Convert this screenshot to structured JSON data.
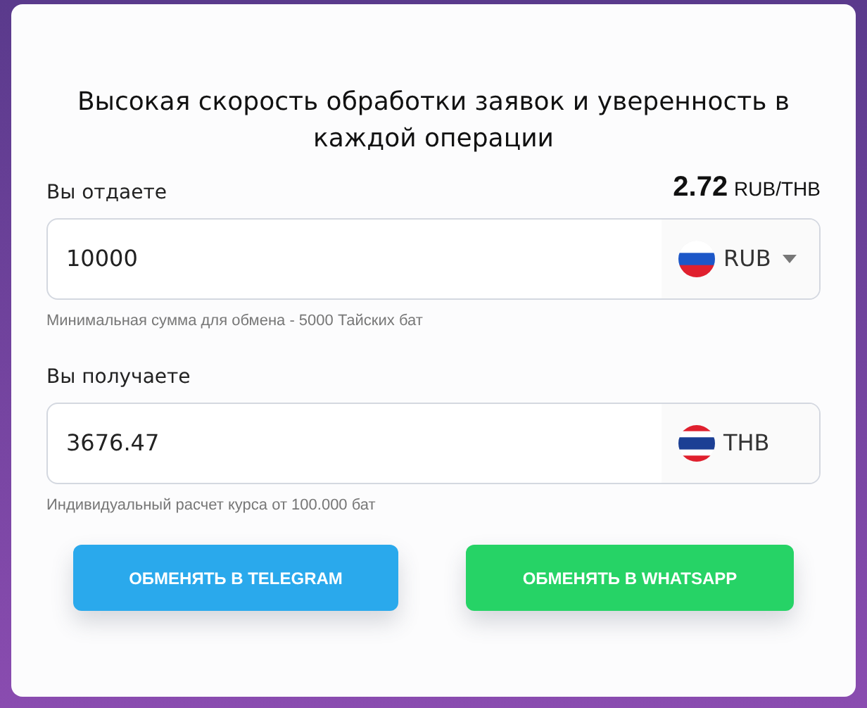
{
  "title": "Высокая скорость обработки заявок и уверенность в каждой операции",
  "rate": {
    "value": "2.72",
    "pair": "RUB/THB"
  },
  "fields": [
    {
      "label": "Вы отдаете",
      "value": "10000",
      "currency": "RUB",
      "kind": "russia",
      "dropdown": true,
      "hint": "Минимальная сумма для обмена - 5000 Тайских бат"
    },
    {
      "label": "Вы получаете",
      "value": "3676.47",
      "currency": "THB",
      "kind": "thailand",
      "dropdown": false,
      "hint": "Индивидуальный расчет курса от 100.000 бат"
    }
  ],
  "buttons": [
    {
      "label": "ОБМЕНЯТЬ В TELEGRAM",
      "color": "#2aa9ec"
    },
    {
      "label": "ОБМЕНЯТЬ В WHATSAPP",
      "color": "#26d366"
    }
  ]
}
